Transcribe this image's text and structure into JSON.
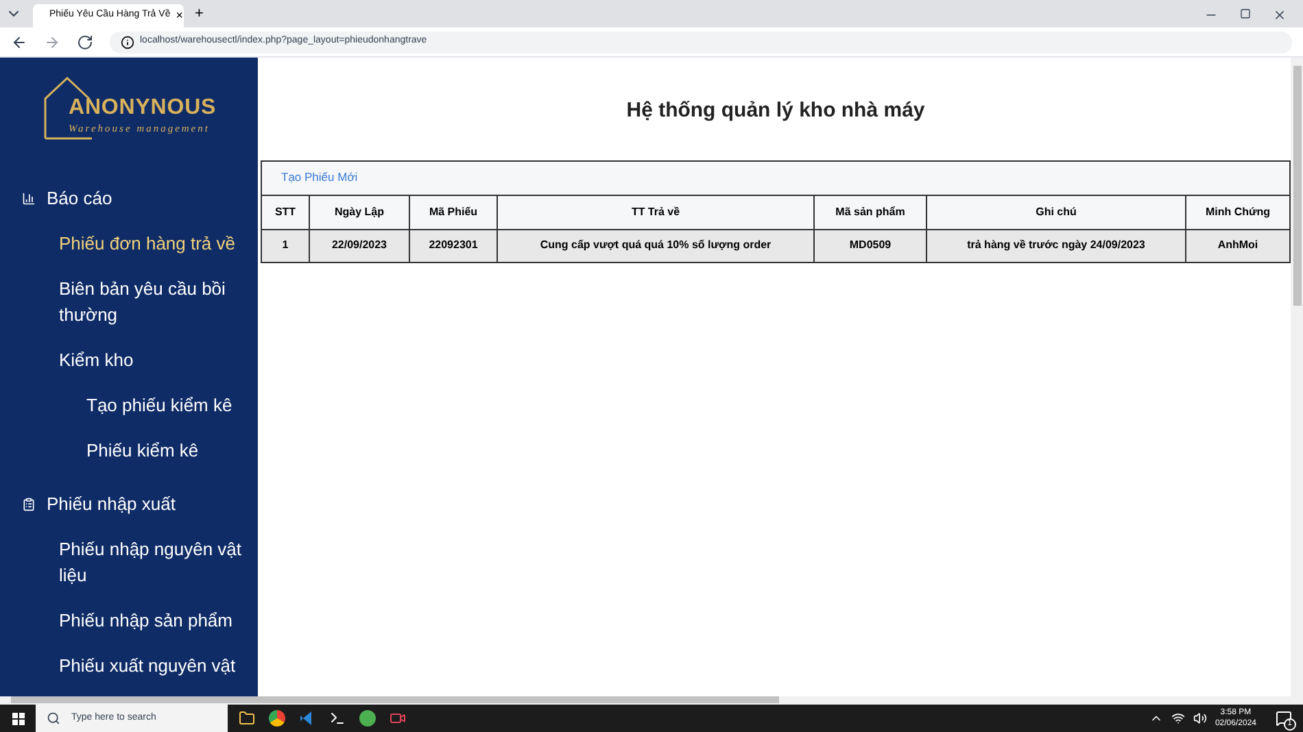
{
  "browser": {
    "tab_title": "Phiếu Yêu Cầu Hàng Trả Về",
    "tab_close": "×",
    "new_tab": "+",
    "url": "localhost/warehousectl/index.php?page_layout=phieudonhangtrave"
  },
  "logo": {
    "name": "ANONYNOUS",
    "tagline": "Warehouse management"
  },
  "sidebar": {
    "sections": [
      {
        "label": "Báo cáo",
        "children": [
          {
            "label": "Phiếu đơn hàng trả về",
            "selected": true
          },
          {
            "label": "Biên bản yêu cầu bồi thường",
            "selected": false
          },
          {
            "label": "Kiểm kho",
            "selected": false,
            "children": [
              {
                "label": "Tạo phiếu kiểm kê",
                "selected": false
              },
              {
                "label": "Phiếu kiểm kê",
                "selected": false
              }
            ]
          }
        ]
      },
      {
        "label": "Phiếu nhập xuất",
        "children": [
          {
            "label": "Phiếu nhập nguyên vật liệu",
            "selected": false
          },
          {
            "label": "Phiếu nhập sản phẩm",
            "selected": false
          },
          {
            "label": "Phiếu xuất nguyên vật",
            "selected": false
          }
        ]
      }
    ]
  },
  "page": {
    "title": "Hệ thống quản lý kho nhà máy",
    "create_link": "Tạo Phiếu Mới"
  },
  "table": {
    "columns": [
      "STT",
      "Ngày Lập",
      "Mã Phiếu",
      "TT Trả về",
      "Mã sản phẩm",
      "Ghi chú",
      "Minh Chứng"
    ],
    "rows": [
      [
        "1",
        "22/09/2023",
        "22092301",
        "Cung cấp vượt quá quá 10% số lượng order",
        "MD0509",
        "trả hàng về trước ngày 24/09/2023",
        "AnhMoi"
      ]
    ]
  },
  "taskbar": {
    "search_placeholder": "Type here to search",
    "time": "3:58 PM",
    "date": "02/06/2024",
    "notifications": "1"
  }
}
